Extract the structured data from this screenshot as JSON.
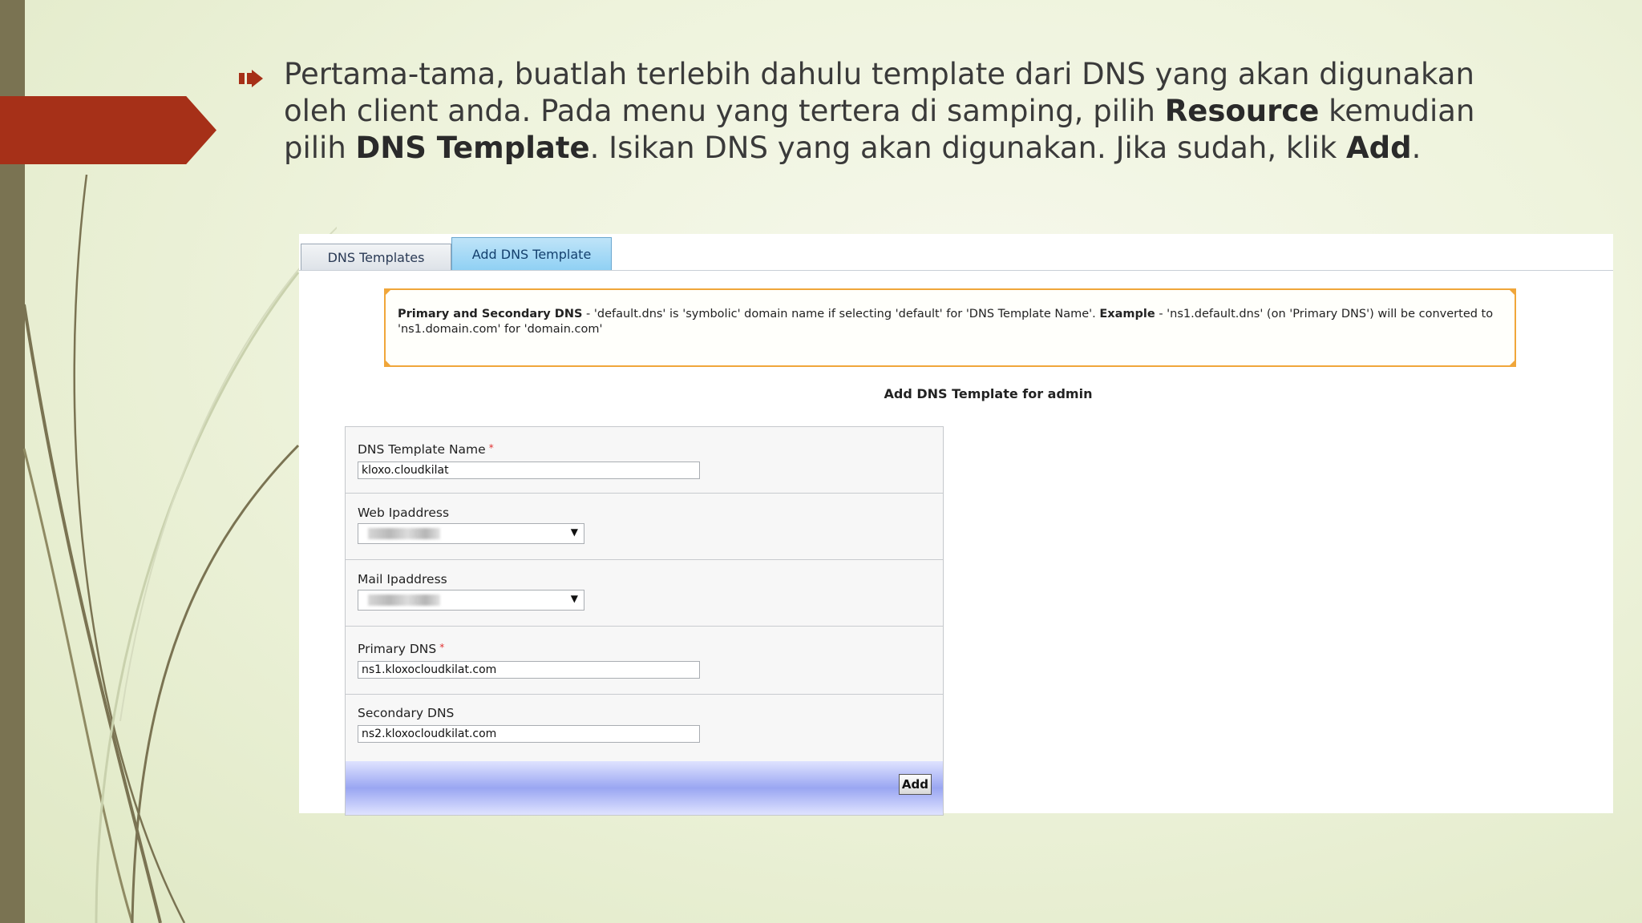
{
  "slide": {
    "bullet": {
      "part1": "Pertama-tama, buatlah terlebih dahulu template dari DNS yang akan digunakan oleh client anda. Pada menu yang tertera di samping, pilih ",
      "bold1": "Resource",
      "part2": " kemudian pilih ",
      "bold2": "DNS Template",
      "part3": ". Isikan DNS yang akan digunakan. Jika sudah, klik ",
      "bold3": "Add",
      "part4": "."
    },
    "colors": {
      "accent_red": "#a63018",
      "bar_olive": "#7a7352",
      "note_border": "#f0a63a"
    }
  },
  "screenshot": {
    "tabs": {
      "templates": "DNS Templates",
      "add": "Add DNS Template"
    },
    "note": {
      "bold1": "Primary and Secondary DNS",
      "text1": " - 'default.dns' is 'symbolic' domain name if selecting 'default' for 'DNS Template Name'. ",
      "bold2": "Example",
      "text2": " - 'ns1.default.dns' (on 'Primary DNS') will be converted to 'ns1.domain.com' for 'domain.com'"
    },
    "heading": "Add DNS Template for admin",
    "form": {
      "template_name": {
        "label": "DNS Template Name",
        "required_mark": "*",
        "value": "kloxo.cloudkilat"
      },
      "web_ip": {
        "label": "Web Ipaddress",
        "caret": "▼"
      },
      "mail_ip": {
        "label": "Mail Ipaddress",
        "caret": "▼"
      },
      "primary_dns": {
        "label": "Primary DNS",
        "required_mark": "*",
        "value": "ns1.kloxocloudkilat.com"
      },
      "secondary_dns": {
        "label": "Secondary DNS",
        "value": "ns2.kloxocloudkilat.com"
      },
      "add_label": "Add"
    }
  }
}
